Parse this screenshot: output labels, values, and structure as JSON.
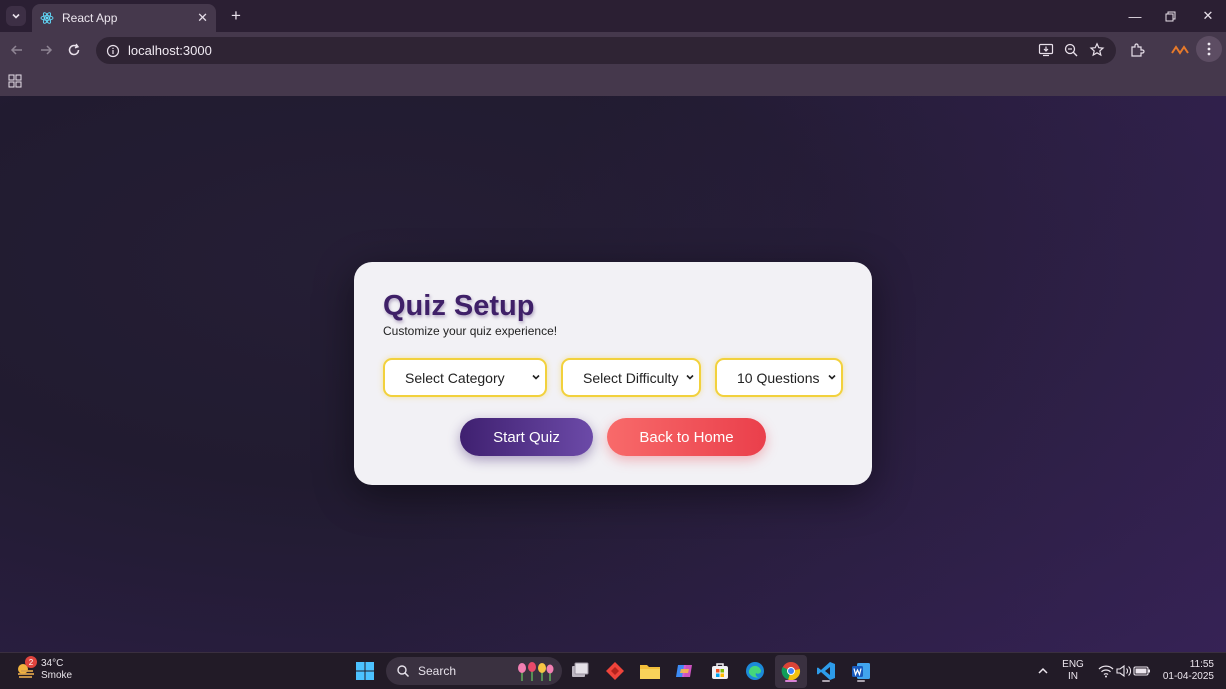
{
  "browser": {
    "tab_title": "React App",
    "url": "localhost:3000"
  },
  "quiz": {
    "title": "Quiz Setup",
    "subtitle": "Customize your quiz experience!",
    "category_select": "Select Category",
    "difficulty_select": "Select Difficulty",
    "questions_select": "10 Questions",
    "start_button": "Start Quiz",
    "home_button": "Back to Home"
  },
  "colors": {
    "title": "#3f2068",
    "select_border": "#f2d13c",
    "start_button": "#4b2a80",
    "home_button": "#f25a5f",
    "page_bg": "#211b30"
  },
  "taskbar": {
    "weather_temp": "34°C",
    "weather_desc": "Smoke",
    "weather_badge": "2",
    "search_placeholder": "Search",
    "language_line1": "ENG",
    "language_line2": "IN",
    "time": "11:55",
    "date": "01-04-2025",
    "pinned_icons": [
      "windows-start-icon",
      "task-view-icon",
      "anydesk-icon",
      "file-explorer-icon",
      "copilot-icon",
      "microsoft-store-icon",
      "edge-icon",
      "chrome-icon",
      "vscode-icon",
      "word-icon"
    ]
  }
}
